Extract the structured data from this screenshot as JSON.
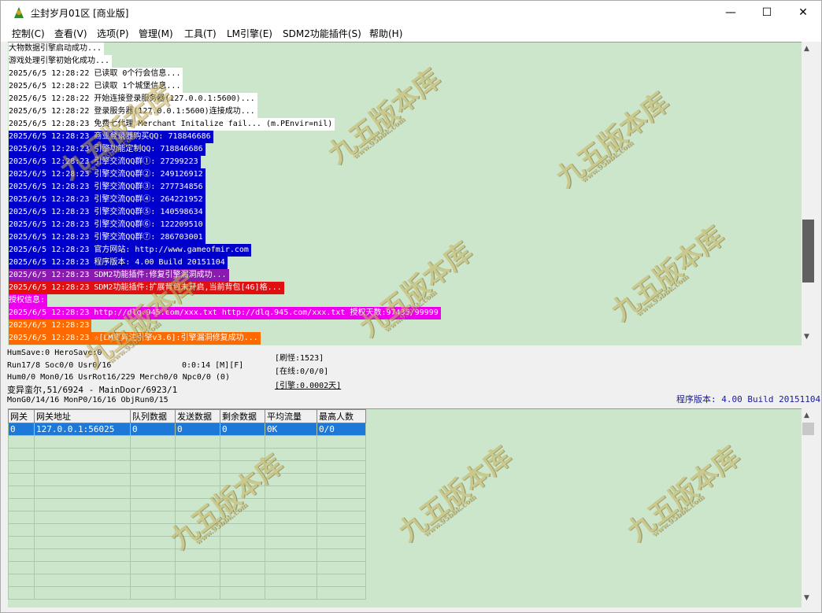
{
  "window": {
    "title": "尘封岁月01区 [商业版]",
    "minimize": "—",
    "maximize": "☐",
    "close": "✕"
  },
  "menu": [
    "控制(C)",
    "查看(V)",
    "选项(P)",
    "管理(M)",
    "工具(T)",
    "LM引擎(E)",
    "SDM2功能插件(S)",
    "帮助(H)"
  ],
  "log": [
    {
      "text": "大物数据引擎启动成功...",
      "bg": "#ffffff",
      "fg": "#000000"
    },
    {
      "text": "游戏处理引擎初始化成功...",
      "bg": "#ffffff",
      "fg": "#000000"
    },
    {
      "text": "2025/6/5 12:28:22 已读取 0个行会信息...",
      "bg": "#ffffff",
      "fg": "#000000"
    },
    {
      "text": "2025/6/5 12:28:22 已读取 1个城堡信息...",
      "bg": "#ffffff",
      "fg": "#000000"
    },
    {
      "text": "2025/6/5 12:28:22 开始连接登录服务器(127.0.0.1:5600)...",
      "bg": "#ffffff",
      "fg": "#000000"
    },
    {
      "text": "2025/6/5 12:28:22 登录服务器(127.0.0.1:5600)连接成功...",
      "bg": "#ffffff",
      "fg": "#000000"
    },
    {
      "text": "2025/6/5 12:28:23 免费七代理 Merchant Initalize fail... (m.PEnvir=nil)",
      "bg": "#ffffff",
      "fg": "#000000"
    },
    {
      "text": "2025/6/5 12:28:23 商业登录器购买QQ: 718846686",
      "bg": "#0000cc",
      "fg": "#ffffff"
    },
    {
      "text": "2025/6/5 12:28:23 引擎功能定制QQ: 718846686",
      "bg": "#0000cc",
      "fg": "#ffffff"
    },
    {
      "text": "2025/6/5 12:28:23 引擎交流QQ群①: 27299223",
      "bg": "#0000cc",
      "fg": "#ffffff"
    },
    {
      "text": "2025/6/5 12:28:23 引擎交流QQ群②: 249126912",
      "bg": "#0000cc",
      "fg": "#ffffff"
    },
    {
      "text": "2025/6/5 12:28:23 引擎交流QQ群③: 277734856",
      "bg": "#0000cc",
      "fg": "#ffffff"
    },
    {
      "text": "2025/6/5 12:28:23 引擎交流QQ群④: 264221952",
      "bg": "#0000cc",
      "fg": "#ffffff"
    },
    {
      "text": "2025/6/5 12:28:23 引擎交流QQ群⑤: 140598634",
      "bg": "#0000cc",
      "fg": "#ffffff"
    },
    {
      "text": "2025/6/5 12:28:23 引擎交流QQ群⑥: 122209510",
      "bg": "#0000cc",
      "fg": "#ffffff"
    },
    {
      "text": "2025/6/5 12:28:23 引擎交流QQ群⑦: 286703001",
      "bg": "#0000cc",
      "fg": "#ffffff"
    },
    {
      "text": "2025/6/5 12:28:23 官方网站: http://www.gameofmir.com",
      "bg": "#0000cc",
      "fg": "#ffffff"
    },
    {
      "text": "2025/6/5 12:28:23 程序版本: 4.00 Build 20151104",
      "bg": "#0000cc",
      "fg": "#ffffff"
    },
    {
      "text": "2025/6/5 12:28:23 SDM2功能插件:修复引擎漏洞成功...",
      "bg": "#8a1ab0",
      "fg": "#ffffff"
    },
    {
      "text": "2025/6/5 12:28:23 SDM2功能插件:扩展背包未开启,当前背包[46]格...",
      "bg": "#e01010",
      "fg": "#ffffff"
    },
    {
      "text": "授权信息:",
      "bg": "#ee00ee",
      "fg": "#ffffff"
    },
    {
      "text": "2025/6/5 12:28:23 http://dlq.945.com/xxx.txt http://dlq.945.com/xxx.txt 授权天数:97435/99999",
      "bg": "#ee00ee",
      "fg": "#ffffff"
    },
    {
      "text": "2025/6/5 12:28:23",
      "bg": "#ff6a00",
      "fg": "#ffffff"
    },
    {
      "text": "2025/6/5 12:28:23 ☆[LM变异注引擎v3.6]:引擎漏洞修复成功...",
      "bg": "#ff6a00",
      "fg": "#ffffff"
    }
  ],
  "status": {
    "line1": "HumSave:0 HeroSave:0",
    "line2": "Run17/8 Soc0/0 Usr0/16",
    "timer": "0:0:14 [M][F]",
    "line3": "Hum0/0 Mon0/16 UsrRot16/229 Merch0/0 Npc0/0 (0)",
    "line4": "变异蛮尔,51/6924 - MainDoor/6923/1",
    "line5": "MonG0/14/16 MonP0/16/16 ObjRun0/15",
    "refresh": "[刷怪:1523]",
    "online": "[在线:0/0/0]",
    "engine": "[引擎:0.0002天]",
    "version": "程序版本: 4.00 Build 20151104"
  },
  "grid": {
    "headers": [
      "网关",
      "网关地址",
      "队列数据",
      "发送数据",
      "剩余数据",
      "平均流量",
      "最高人数"
    ],
    "rows": [
      [
        "0",
        "127.0.0.1:56025",
        "0",
        "0",
        "0",
        "0K",
        "0/0"
      ]
    ]
  },
  "watermark": {
    "main": "九五版本库",
    "url": "www.95bbk.com"
  }
}
